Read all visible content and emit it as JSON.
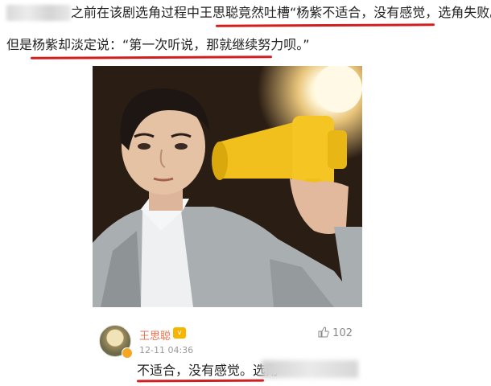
{
  "article": {
    "line1": "之前在该剧选角过程中王思聪竟然吐槽“杨紫不适合，没有感觉，选角失败。”",
    "line2": "但是杨紫却淡定说：“第一次听说，那就继续努力呗。”"
  },
  "comment": {
    "username": "王思聪",
    "time": "12-11 04:36",
    "likes": "102",
    "text": "不适合，没有感觉。选角"
  },
  "colors": {
    "underline": "#d11f1f",
    "username": "#eb7350"
  },
  "icons": {
    "like": "thumbs-up-icon",
    "verified": "verified-badge-icon"
  }
}
